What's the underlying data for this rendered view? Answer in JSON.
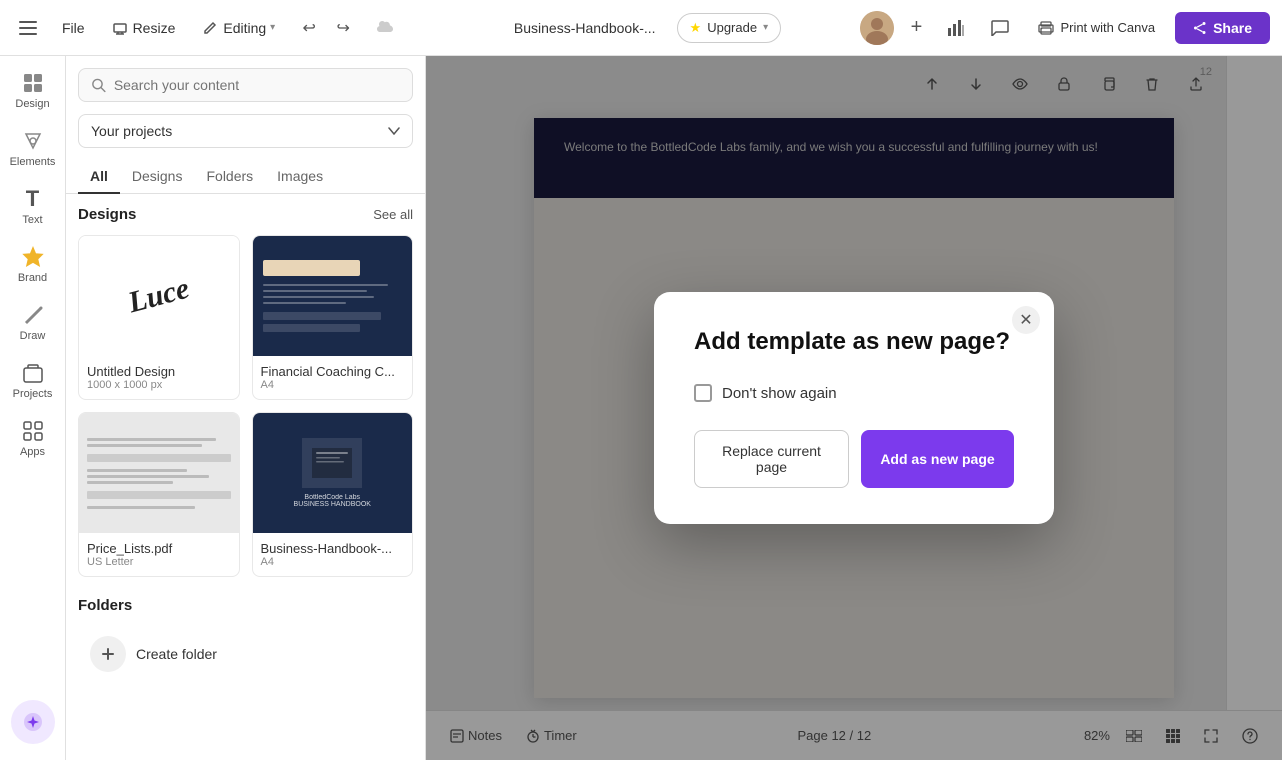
{
  "toolbar": {
    "menu_label": "☰",
    "file_label": "File",
    "resize_label": "Resize",
    "editing_label": "Editing",
    "editing_chevron": "▾",
    "undo_icon": "↩",
    "redo_icon": "↪",
    "save_status_icon": "☁",
    "doc_title": "Business-Handbook-...",
    "upgrade_label": "Upgrade",
    "upgrade_icon": "⭐",
    "timer_icon": "⏱",
    "comment_icon": "💬",
    "print_label": "Print with Canva",
    "print_icon": "🖨",
    "share_label": "Share",
    "share_icon": "⬆",
    "analytics_icon": "📊",
    "add_page_icon": "+"
  },
  "sidebar": {
    "items": [
      {
        "id": "design",
        "label": "Design",
        "icon": "⬛"
      },
      {
        "id": "elements",
        "label": "Elements",
        "icon": "✦"
      },
      {
        "id": "text",
        "label": "Text",
        "icon": "T"
      },
      {
        "id": "brand",
        "label": "Brand",
        "icon": "👑"
      },
      {
        "id": "draw",
        "label": "Draw",
        "icon": "✏"
      },
      {
        "id": "projects",
        "label": "Projects",
        "icon": "◧"
      },
      {
        "id": "apps",
        "label": "Apps",
        "icon": "⊞"
      }
    ]
  },
  "panel": {
    "search_placeholder": "Search your content",
    "project_select": "Your projects",
    "tabs": [
      "All",
      "Designs",
      "Folders",
      "Images"
    ],
    "active_tab": "All",
    "sections": {
      "designs": {
        "title": "Designs",
        "see_all": "See all",
        "items": [
          {
            "name": "Untitled Design",
            "meta": "1000 x 1000 px",
            "type": "untitled"
          },
          {
            "name": "Financial Coaching C...",
            "meta": "A4",
            "type": "financial"
          },
          {
            "name": "Price_Lists.pdf",
            "meta": "US Letter",
            "type": "pricelist"
          },
          {
            "name": "Business-Handbook-...",
            "meta": "A4",
            "type": "handbook"
          }
        ]
      },
      "folders": {
        "title": "Folders",
        "create_label": "Create folder"
      }
    }
  },
  "canvas": {
    "welcome_text": "Welcome to the BottledCode Labs family, and we wish you a successful and fulfilling journey with us!",
    "page_number": "12",
    "total_pages": "12",
    "page_indicator": "Page 12 / 12"
  },
  "canvas_tools": {
    "items": [
      {
        "id": "up-arrow",
        "icon": "↑"
      },
      {
        "id": "down-arrow",
        "icon": "↓"
      },
      {
        "id": "eye",
        "icon": "👁"
      },
      {
        "id": "lock",
        "icon": "🔒"
      },
      {
        "id": "copy",
        "icon": "⧉"
      },
      {
        "id": "trash",
        "icon": "🗑"
      },
      {
        "id": "export",
        "icon": "⬆"
      }
    ]
  },
  "bottom_toolbar": {
    "notes_label": "Notes",
    "timer_label": "Timer",
    "page_indicator": "Page 12 / 12",
    "zoom_level": "82%",
    "view_icon": "▤",
    "grid_icon": "⊞",
    "fullscreen_icon": "⛶",
    "help_icon": "?"
  },
  "modal": {
    "title": "Add template as new page?",
    "checkbox_label": "Don't show again",
    "replace_btn": "Replace current page",
    "add_new_btn": "Add as new page"
  }
}
